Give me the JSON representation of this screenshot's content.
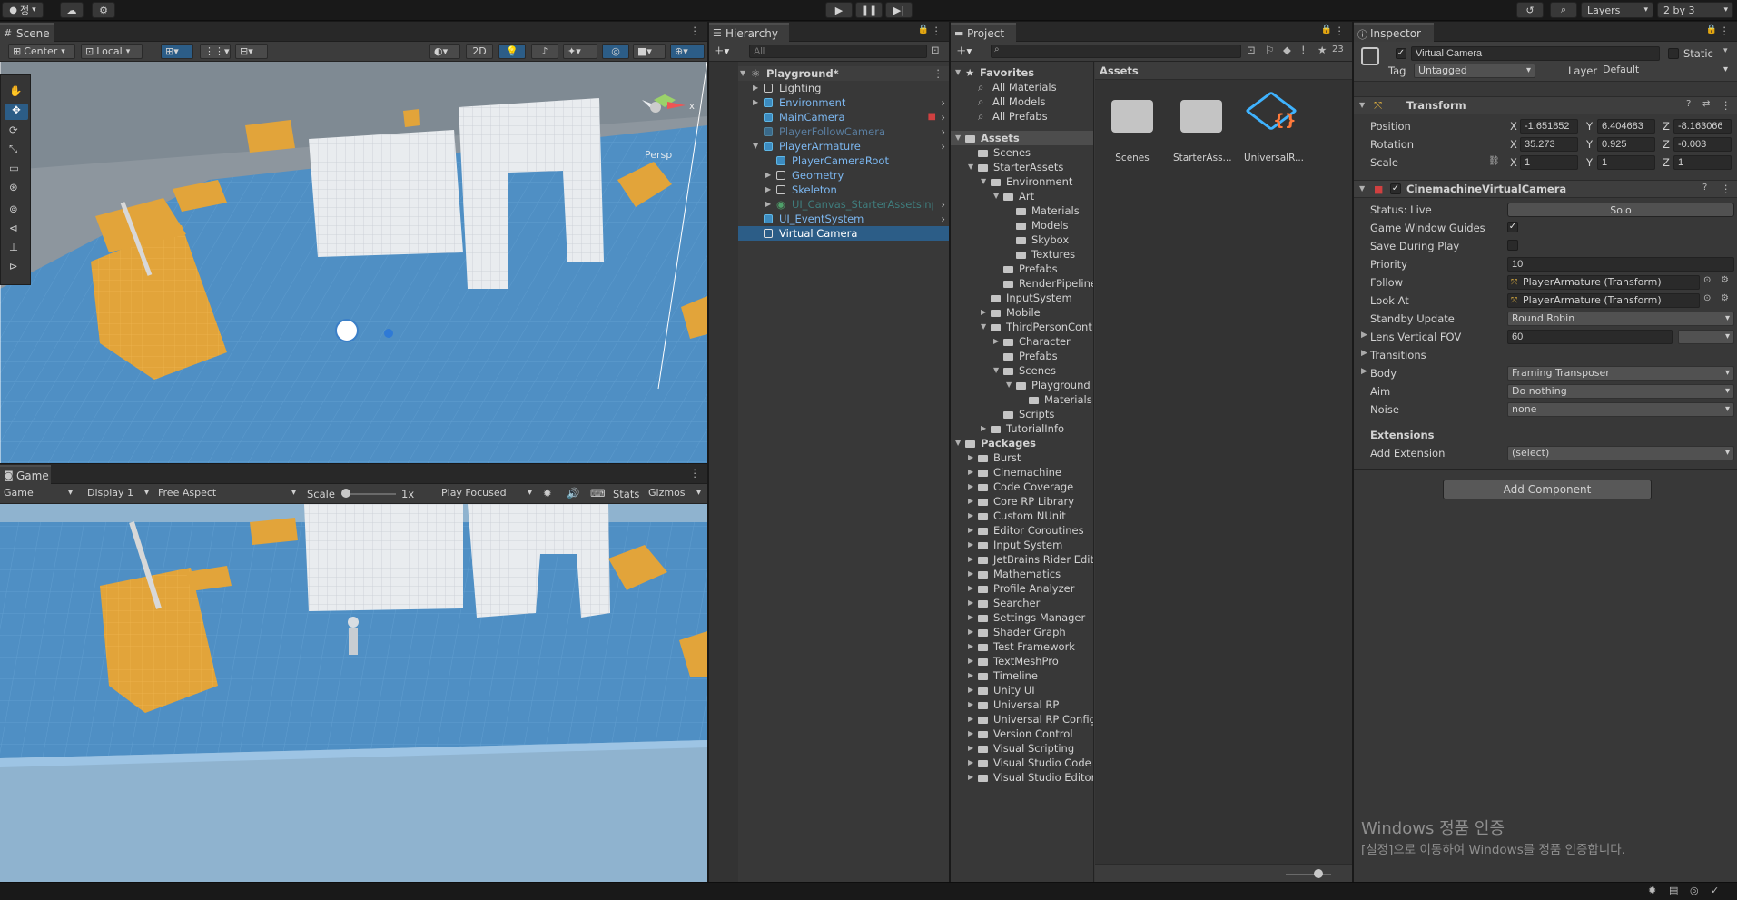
{
  "topbar": {
    "account_label": "정",
    "layers_label": "Layers",
    "layout_label": "2 by 3"
  },
  "scene": {
    "tab_label": "Scene",
    "pivot_label": "Center",
    "space_label": "Local",
    "mode_2d": "2D",
    "persp_label": "Persp"
  },
  "game": {
    "tab_label": "Game",
    "view_select": "Game",
    "display_select": "Display 1",
    "aspect_select": "Free Aspect",
    "scale_label": "Scale",
    "scale_value": "1x",
    "play_mode": "Play Focused",
    "stats_label": "Stats",
    "gizmos_label": "Gizmos"
  },
  "hierarchy": {
    "tab_label": "Hierarchy",
    "search_placeholder": "All",
    "scene_name": "Playground*",
    "items": [
      {
        "label": "Lighting"
      },
      {
        "label": "Environment"
      },
      {
        "label": "MainCamera"
      },
      {
        "label": "PlayerFollowCamera"
      },
      {
        "label": "PlayerArmature"
      },
      {
        "label": "PlayerCameraRoot"
      },
      {
        "label": "Geometry"
      },
      {
        "label": "Skeleton"
      },
      {
        "label": "UI_Canvas_StarterAssetsInp"
      },
      {
        "label": "UI_EventSystem"
      },
      {
        "label": "Virtual Camera"
      }
    ]
  },
  "project": {
    "tab_label": "Project",
    "hidden_count": "23",
    "favorites_label": "Favorites",
    "favorites": [
      "All Materials",
      "All Models",
      "All Prefabs"
    ],
    "assets_root": "Assets",
    "tree": [
      "Scenes",
      "StarterAssets",
      "Environment",
      "Art",
      "Materials",
      "Models",
      "Skybox",
      "Textures",
      "Prefabs",
      "RenderPipeline",
      "InputSystem",
      "Mobile",
      "ThirdPersonCont",
      "Character",
      "Prefabs",
      "Scenes",
      "Playground",
      "Materials",
      "Scripts",
      "TutorialInfo"
    ],
    "packages_label": "Packages",
    "packages": [
      "Burst",
      "Cinemachine",
      "Code Coverage",
      "Core RP Library",
      "Custom NUnit",
      "Editor Coroutines",
      "Input System",
      "JetBrains Rider Edit",
      "Mathematics",
      "Profile Analyzer",
      "Searcher",
      "Settings Manager",
      "Shader Graph",
      "Test Framework",
      "TextMeshPro",
      "Timeline",
      "Unity UI",
      "Universal RP",
      "Universal RP Config",
      "Version Control",
      "Visual Scripting",
      "Visual Studio Code",
      "Visual Studio Editor"
    ],
    "content_header": "Assets",
    "grid_items": [
      "Scenes",
      "StarterAss...",
      "UniversalR..."
    ]
  },
  "inspector": {
    "tab_label": "Inspector",
    "object_name": "Virtual Camera",
    "static_label": "Static",
    "tag_label": "Tag",
    "tag_value": "Untagged",
    "layer_label": "Layer",
    "layer_value": "Default",
    "transform": {
      "title": "Transform",
      "position_label": "Position",
      "rotation_label": "Rotation",
      "scale_label": "Scale",
      "position": [
        "-1.651852",
        "6.404683",
        "-8.163066"
      ],
      "rotation": [
        "35.273",
        "0.925",
        "-0.003"
      ],
      "scale": [
        "1",
        "1",
        "1"
      ],
      "x": "X",
      "y": "Y",
      "z": "Z"
    },
    "vcam": {
      "title": "CinemachineVirtualCamera",
      "status_label": "Status: Live",
      "solo_label": "Solo",
      "guides_label": "Game Window Guides",
      "save_label": "Save During Play",
      "priority_label": "Priority",
      "priority_value": "10",
      "follow_label": "Follow",
      "follow_value": "PlayerArmature (Transform)",
      "lookat_label": "Look At",
      "lookat_value": "PlayerArmature (Transform)",
      "standby_label": "Standby Update",
      "standby_value": "Round Robin",
      "fov_label": "Lens Vertical FOV",
      "fov_value": "60",
      "transitions_label": "Transitions",
      "body_label": "Body",
      "body_value": "Framing Transposer",
      "aim_label": "Aim",
      "aim_value": "Do nothing",
      "noise_label": "Noise",
      "noise_value": "none",
      "extensions_label": "Extensions",
      "add_ext_label": "Add Extension",
      "add_ext_value": "(select)"
    },
    "add_component": "Add Component",
    "watermark_title": "Windows 정품 인증",
    "watermark_text": "[설정]으로 이동하여 Windows를 정품 인증합니다."
  },
  "colors": {
    "accent": "#2c5d87",
    "panel": "#383838",
    "field": "#2a2a2a",
    "link_blue": "#7cb7f0",
    "sky": "#8fb3cf",
    "ground": "#4f8fc4"
  }
}
